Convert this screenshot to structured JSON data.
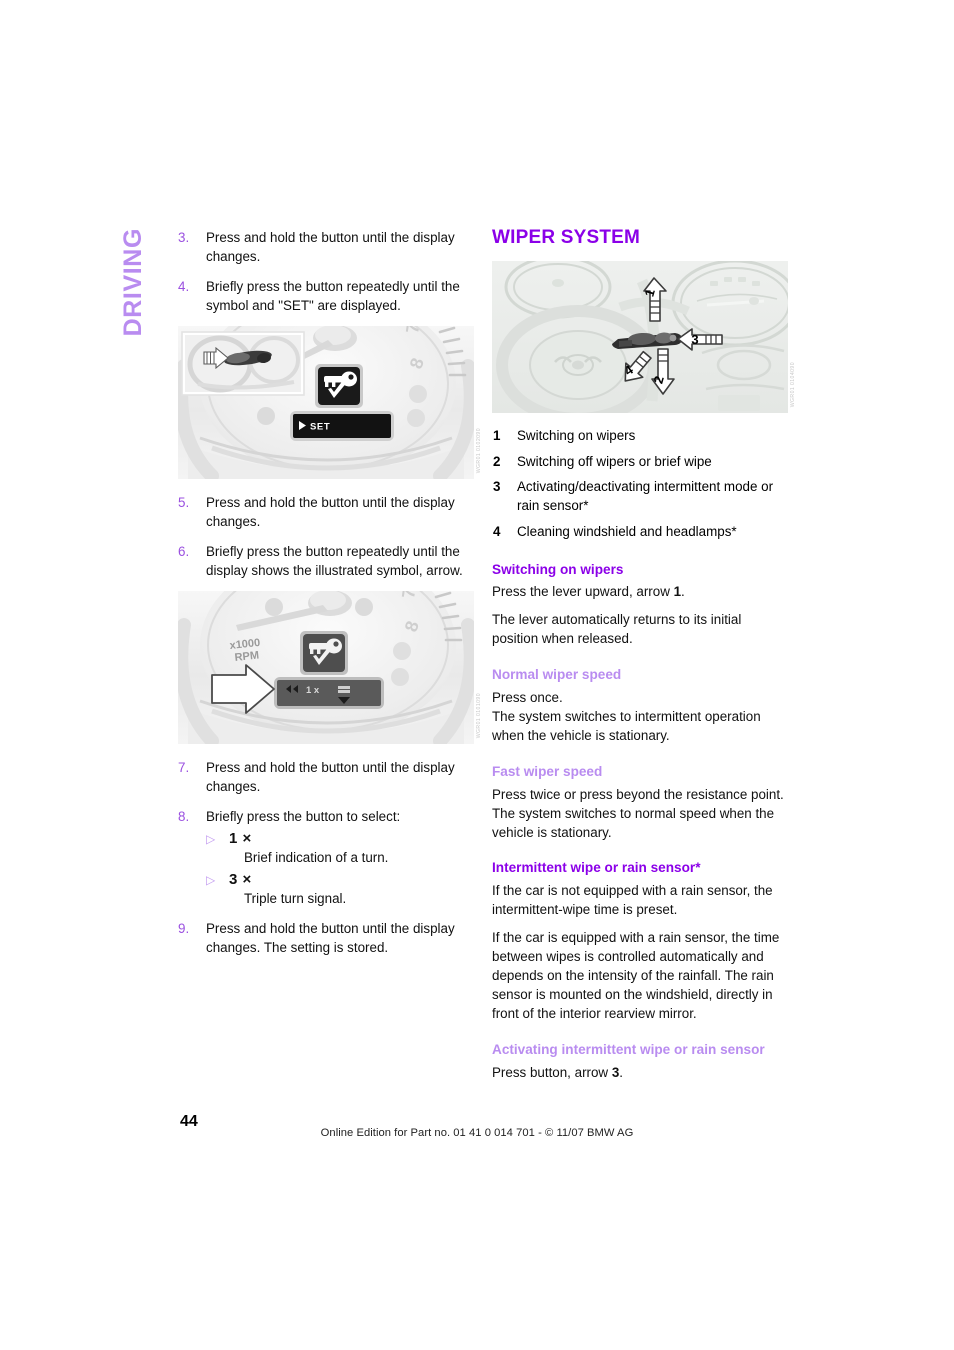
{
  "running_head": "DRIVING",
  "left_column": {
    "steps_group_1": [
      {
        "num": "3.",
        "text": "Press and hold the button until the display changes."
      },
      {
        "num": "4.",
        "text": "Briefly press the button repeatedly until the symbol and \"SET\" are displayed."
      }
    ],
    "figure_1": {
      "name": "instrument-cluster-set-display",
      "display_text": "SET",
      "inset_label": "lever-and-arrow-inset",
      "image_code": "WGR01 0102090"
    },
    "steps_group_2": [
      {
        "num": "5.",
        "text": "Press and hold the button until the display changes."
      },
      {
        "num": "6.",
        "text": "Briefly press the button repeatedly until the display shows the illustrated symbol, arrow."
      }
    ],
    "figure_2": {
      "name": "instrument-cluster-turn-signal-display",
      "gauge_label_line1": "x1000",
      "gauge_label_line2": "RPM",
      "display_value": "1 x",
      "image_code": "WGR01 0101090"
    },
    "steps_group_3": [
      {
        "num": "7.",
        "text": "Press and hold the button until the display changes."
      },
      {
        "num": "8.",
        "text": "Briefly press the button to select:"
      }
    ],
    "select_options": [
      {
        "bullet": "▷",
        "key": "1 ×",
        "desc": "Brief indication of a turn."
      },
      {
        "bullet": "▷",
        "key": "3 ×",
        "desc": "Triple turn signal."
      }
    ],
    "steps_group_4": [
      {
        "num": "9.",
        "text": "Press and hold the button until the display changes. The setting is stored."
      }
    ]
  },
  "right_column": {
    "title": "WIPER SYSTEM",
    "figure": {
      "name": "steering-column-wiper-lever",
      "callout_1": "1",
      "callout_2": "2",
      "callout_3": "3",
      "callout_4": "4",
      "image_code": "WGR01 0104090"
    },
    "legend": [
      {
        "num": "1",
        "text": "Switching on wipers"
      },
      {
        "num": "2",
        "text": "Switching off wipers or brief wipe"
      },
      {
        "num": "3",
        "text": "Activating/deactivating intermittent mode or rain sensor*"
      },
      {
        "num": "4",
        "text": "Cleaning windshield and headlamps*"
      }
    ],
    "sections": [
      {
        "heading": "Switching on wipers",
        "heading_level": "h2",
        "paragraphs": [
          {
            "pre": "Press the lever upward, arrow ",
            "bold": "1",
            "post": "."
          },
          {
            "pre": "The lever automatically returns to its initial position when released.",
            "bold": "",
            "post": ""
          }
        ]
      },
      {
        "heading": "Normal wiper speed",
        "heading_level": "h3",
        "paragraphs": [
          {
            "pre": "Press once.",
            "bold": "",
            "post": ""
          },
          {
            "pre": "The system switches to intermittent operation when the vehicle is stationary.",
            "bold": "",
            "post": ""
          }
        ]
      },
      {
        "heading": "Fast wiper speed",
        "heading_level": "h3",
        "paragraphs": [
          {
            "pre": "Press twice or press beyond the resistance point.",
            "bold": "",
            "post": ""
          },
          {
            "pre": "The system switches to normal speed when the vehicle is stationary.",
            "bold": "",
            "post": ""
          }
        ]
      },
      {
        "heading": "Intermittent wipe or rain sensor*",
        "heading_level": "h2",
        "paragraphs": [
          {
            "pre": "If the car is not equipped with a rain sensor, the intermittent-wipe time is preset.",
            "bold": "",
            "post": ""
          },
          {
            "pre": "If the car is equipped with a rain sensor, the time between wipes is controlled automatically and depends on the intensity of the rainfall. The rain sensor is mounted on the windshield, directly in front of the interior rearview mirror.",
            "bold": "",
            "post": ""
          }
        ]
      },
      {
        "heading": "Activating intermittent wipe or rain sensor",
        "heading_level": "h3",
        "paragraphs": [
          {
            "pre": "Press button, arrow ",
            "bold": "3",
            "post": "."
          }
        ]
      }
    ]
  },
  "footer": {
    "page_number": "44",
    "note": "Online Edition for Part no. 01 41 0 014 701 - © 11/07 BMW AG"
  },
  "colors": {
    "heading_primary": "#8b00e8",
    "heading_secondary": "#b98cf0",
    "step_number": "#9b51e0",
    "bullet": "#c29af0",
    "body_text": "#111111"
  }
}
